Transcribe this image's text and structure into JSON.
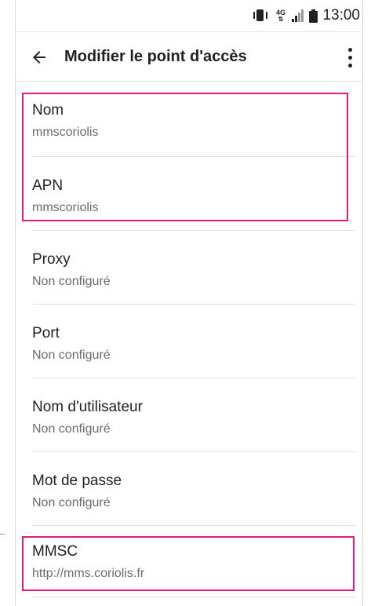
{
  "status_bar": {
    "time": "13:00",
    "icons": [
      "vibrate-icon",
      "4g-icon",
      "signal-icon",
      "battery-icon"
    ]
  },
  "app_bar": {
    "back_icon": "arrow-left-icon",
    "title": "Modifier le point d'accès",
    "menu_icon": "more-vert-icon"
  },
  "settings": [
    {
      "label": "Nom",
      "value": "mmscoriolis"
    },
    {
      "label": "APN",
      "value": "mmscoriolis"
    },
    {
      "label": "Proxy",
      "value": "Non configuré"
    },
    {
      "label": "Port",
      "value": "Non configuré"
    },
    {
      "label": "Nom d'utilisateur",
      "value": "Non configuré"
    },
    {
      "label": "Mot de passe",
      "value": "Non configuré"
    },
    {
      "label": "MMSC",
      "value": "http://mms.coriolis.fr"
    }
  ],
  "colors": {
    "highlight": "#e4197a",
    "text_primary": "#212121",
    "text_secondary": "#6b6b6b",
    "divider": "#e0e0e0"
  }
}
